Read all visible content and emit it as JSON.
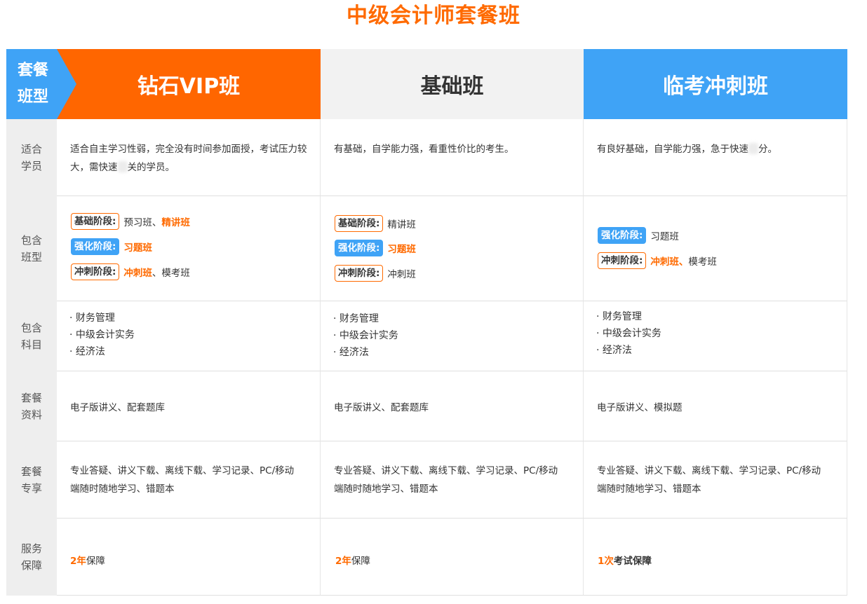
{
  "title": "中级会计师套餐班",
  "header": {
    "corner_line1": "套餐",
    "corner_line2": "班型",
    "col1": "钻石VIP班",
    "col2": "基础班",
    "col3": "临考冲刺班"
  },
  "colors": {
    "orange": "#ff6600",
    "blue": "#3fa3f6",
    "gray_header": "#f2f2f2",
    "label_bg": "#eeeeee"
  },
  "rows": {
    "students": {
      "label": "适合学员",
      "col1_a": "适合自主学习性弱，完全没有时间参加面授，考试压力较大，需快速",
      "col1_b": "关的学员。",
      "col2": "有基础，自学能力强，看重性价比的考生。",
      "col3_a": "有良好基础，自学能力强，急于快速",
      "col3_b": "分。"
    },
    "classes": {
      "label": "包含班型",
      "tag_basic": "基础阶段:",
      "tag_strengthen": "强化阶段:",
      "tag_sprint": "冲刺阶段:",
      "col1_basic_plain": "预习班、",
      "col1_basic_hl": "精讲班",
      "col1_strengthen_hl": "习题班",
      "col1_sprint_hl": "冲刺班",
      "col1_sprint_plain": "、模考班",
      "col2_basic_plain": "精讲班",
      "col2_strengthen_hl": "习题班",
      "col2_sprint_plain": "冲刺班",
      "col3_strengthen_plain": "习题班",
      "col3_sprint_hl": "冲刺班、",
      "col3_sprint_plain": "模考班"
    },
    "subjects": {
      "label": "包含科目",
      "items": [
        "· 财务管理",
        "· 中级会计实务",
        "· 经济法"
      ]
    },
    "materials": {
      "label": "套餐资料",
      "col1": "电子版讲义、配套题库",
      "col2": "电子版讲义、配套题库",
      "col3": "电子版讲义、模拟题"
    },
    "perks": {
      "label": "套餐专享",
      "text_line1": "专业答疑、讲义下载、离线下载、学习记录、PC/移动",
      "text_line2": "端随时随地学习、错题本"
    },
    "guarantee": {
      "label": "服务保障",
      "col1_num": "2年",
      "col1_text": "保障",
      "col2_num": "2年",
      "col2_text": "保障",
      "col3_num": "1次",
      "col3_text": "考试保障"
    }
  }
}
